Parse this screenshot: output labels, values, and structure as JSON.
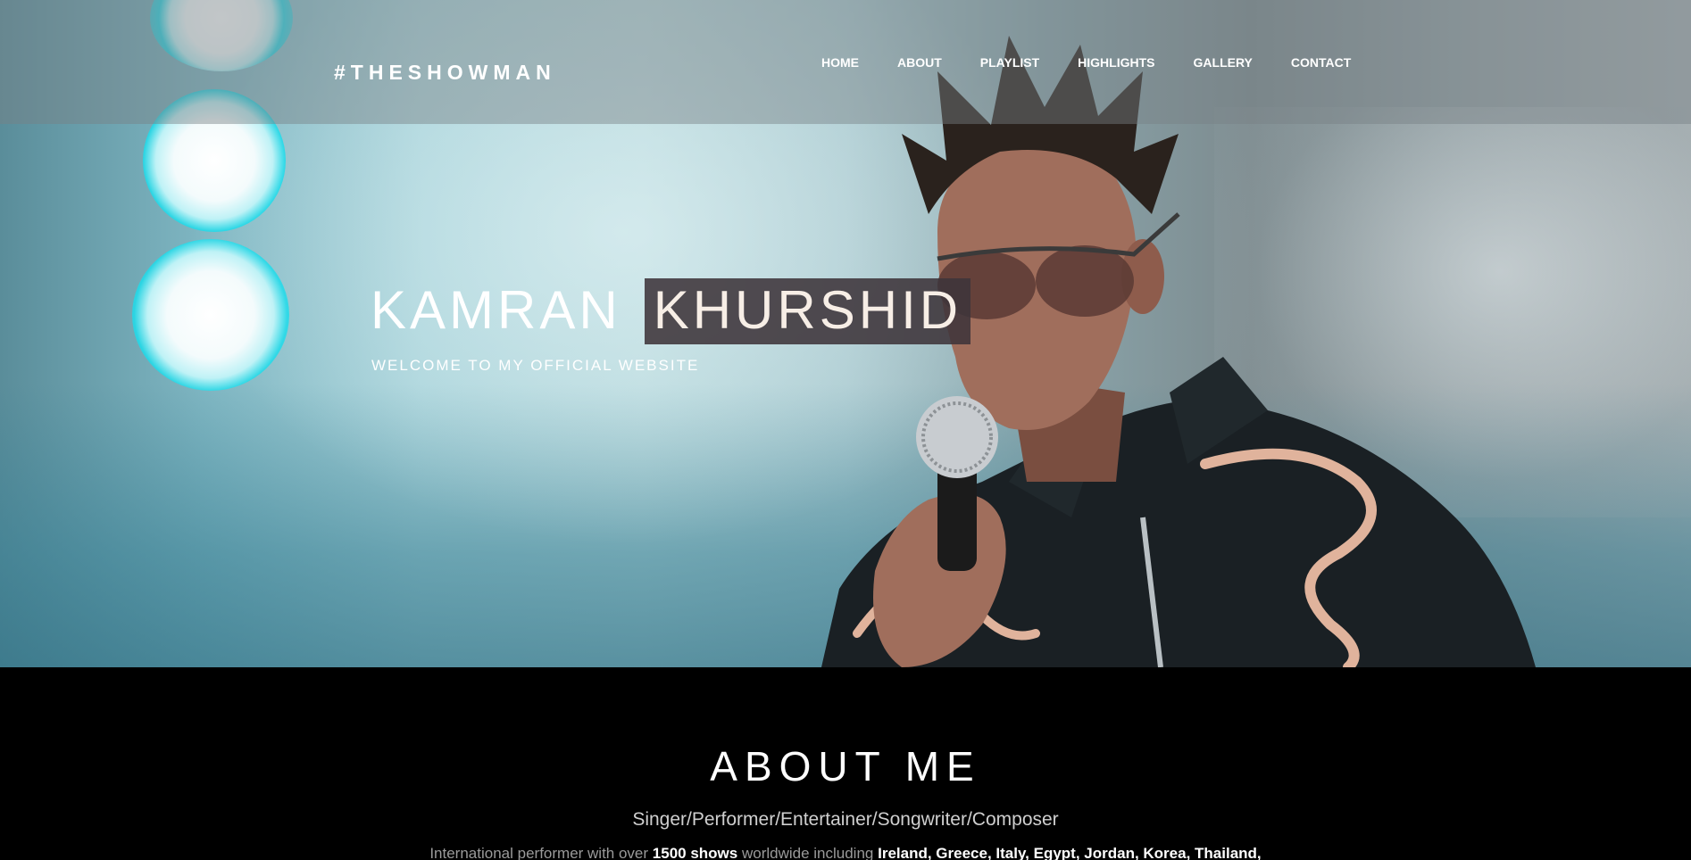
{
  "navbar": {
    "brand": "#THESHOWMAN",
    "menu": [
      {
        "label": "HOME"
      },
      {
        "label": "ABOUT"
      },
      {
        "label": "PLAYLIST"
      },
      {
        "label": "HIGHLIGHTS"
      },
      {
        "label": "GALLERY"
      },
      {
        "label": "CONTACT"
      }
    ]
  },
  "hero": {
    "first_name": "KAMRAN",
    "last_name": "KHURSHID",
    "subtitle": "WELCOME TO MY OFFICIAL WEBSITE",
    "image_alt_icon": "singer-with-microphone-photo"
  },
  "about": {
    "title": "ABOUT ME",
    "roles": "Singer/Performer/Entertainer/Songwriter/Composer",
    "intro_prefix": "International performer with over ",
    "intro_shows": "1500 shows",
    "intro_middle": " worldwide including ",
    "intro_countries": "Ireland, Greece, Italy, Egypt, Jordan, Korea, Thailand,"
  },
  "colors": {
    "nav_overlay": "#787f84",
    "highlight_box": "#3e343a",
    "about_background": "#000000",
    "stage_light": "#1edceb"
  }
}
